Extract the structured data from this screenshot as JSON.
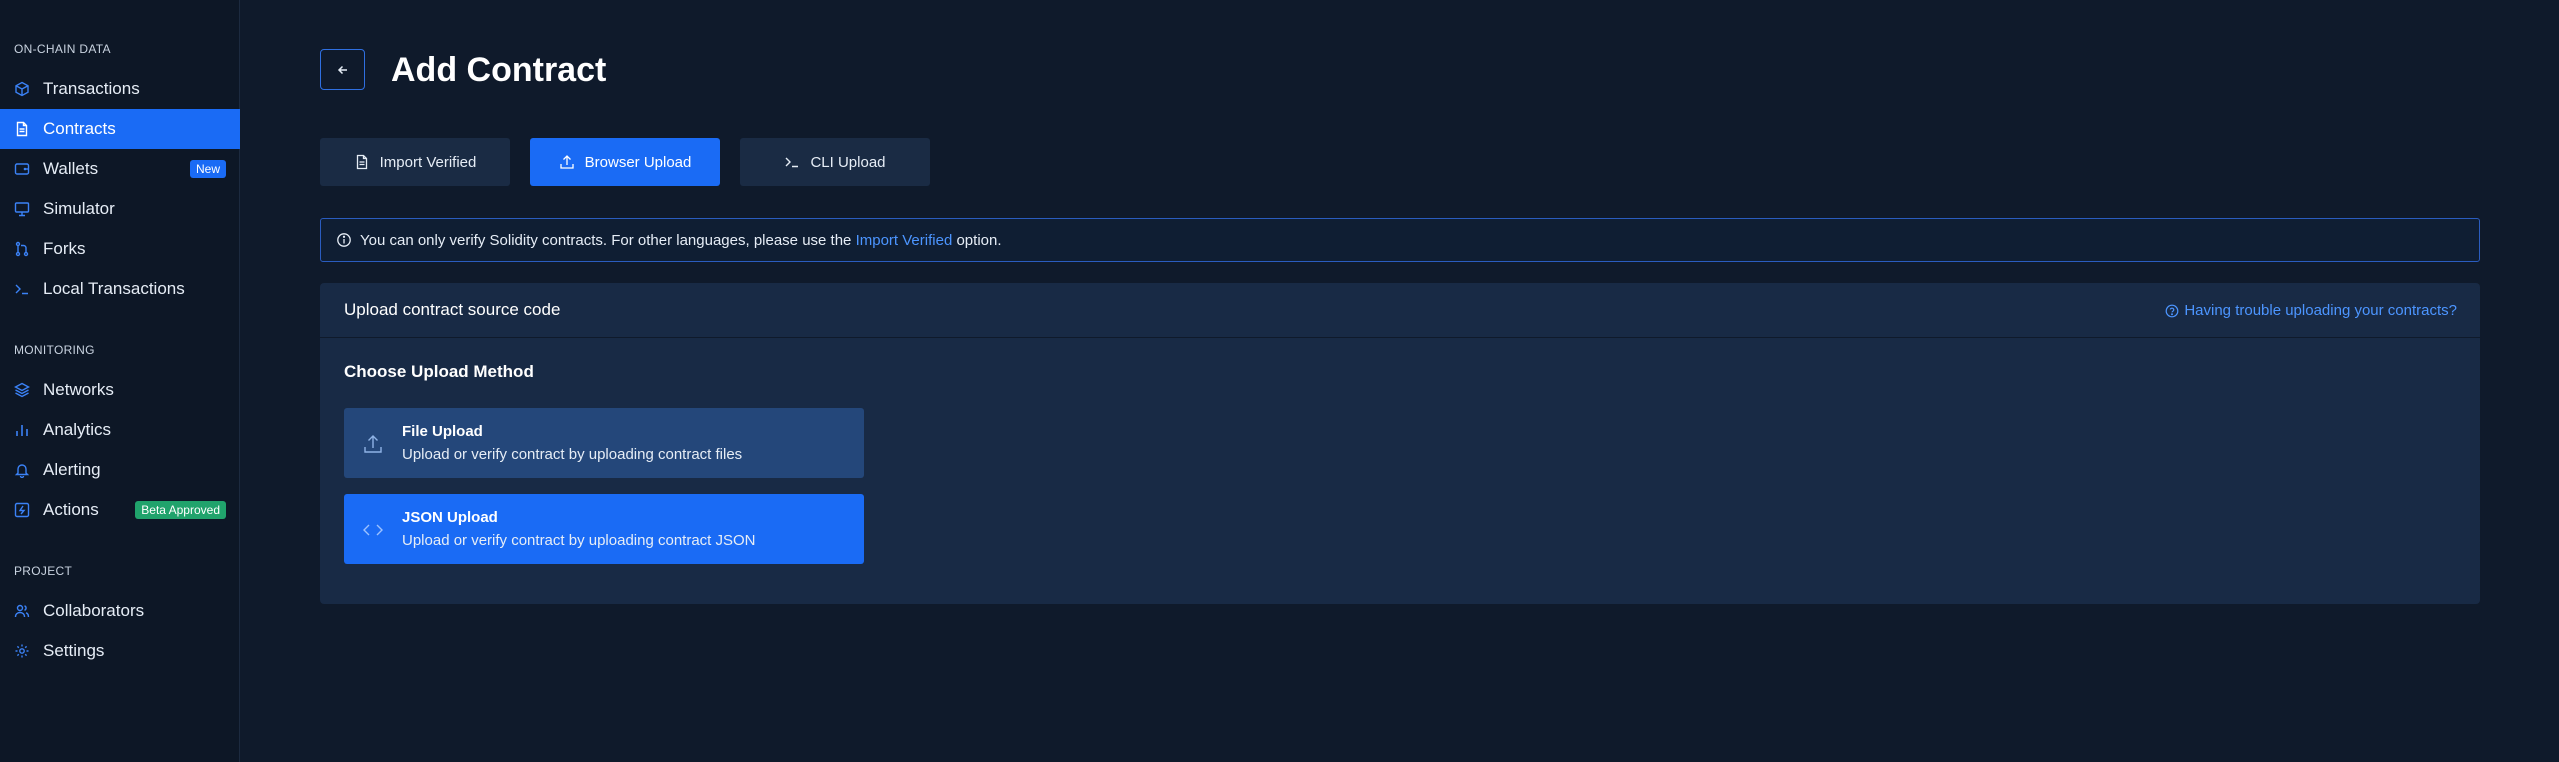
{
  "sidebar": {
    "sections": [
      {
        "title": "ON-CHAIN DATA",
        "items": [
          {
            "label": "Transactions",
            "icon": "cube-icon"
          },
          {
            "label": "Contracts",
            "icon": "document-icon",
            "active": true
          },
          {
            "label": "Wallets",
            "icon": "wallet-icon",
            "badge": "New"
          },
          {
            "label": "Simulator",
            "icon": "monitor-icon"
          },
          {
            "label": "Forks",
            "icon": "git-fork-icon"
          },
          {
            "label": "Local Transactions",
            "icon": "terminal-icon"
          }
        ]
      },
      {
        "title": "MONITORING",
        "items": [
          {
            "label": "Networks",
            "icon": "layers-icon"
          },
          {
            "label": "Analytics",
            "icon": "bar-chart-icon"
          },
          {
            "label": "Alerting",
            "icon": "bell-icon"
          },
          {
            "label": "Actions",
            "icon": "lightning-icon",
            "badge": "Beta Approved"
          }
        ]
      },
      {
        "title": "PROJECT",
        "items": [
          {
            "label": "Collaborators",
            "icon": "users-icon"
          },
          {
            "label": "Settings",
            "icon": "gear-icon"
          }
        ]
      }
    ]
  },
  "header": {
    "title": "Add Contract"
  },
  "tabs": [
    {
      "label": "Import Verified",
      "icon": "document-icon"
    },
    {
      "label": "Browser Upload",
      "icon": "upload-icon",
      "active": true
    },
    {
      "label": "CLI Upload",
      "icon": "terminal-icon"
    }
  ],
  "notice": {
    "text_before": "You can only verify Solidity contracts. For other languages, please use the ",
    "link": "Import Verified",
    "text_after": " option."
  },
  "panel": {
    "title": "Upload contract source code",
    "help_link": "Having trouble uploading your contracts?",
    "choose_title": "Choose Upload Method",
    "methods": [
      {
        "title": "File Upload",
        "description": "Upload or verify contract by uploading contract files",
        "icon": "upload-icon"
      },
      {
        "title": "JSON Upload",
        "description": "Upload or verify contract by uploading contract JSON",
        "icon": "code-icon"
      }
    ]
  },
  "colors": {
    "accent": "#1a6bf5",
    "background": "#0f1a2b",
    "sidebar": "#0d1726",
    "panel": "#182a45",
    "link": "#4c95ff",
    "beta_badge": "#20a36c"
  }
}
